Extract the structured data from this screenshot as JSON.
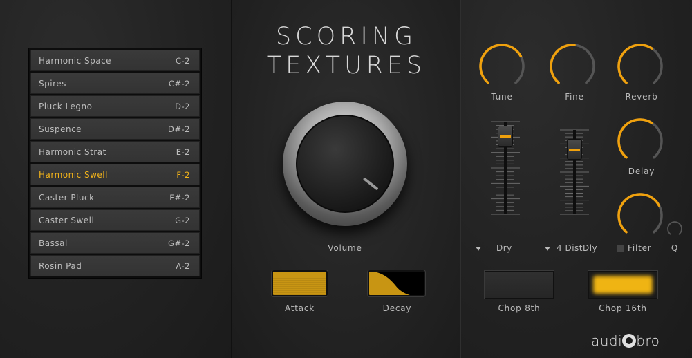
{
  "title": {
    "line1": "SCORING",
    "line2": "TEXTURES"
  },
  "presets": [
    {
      "name": "Harmonic Space",
      "note": "C-2"
    },
    {
      "name": "Spires",
      "note": "C#-2"
    },
    {
      "name": "Pluck Legno",
      "note": "D-2"
    },
    {
      "name": "Suspence",
      "note": "D#-2"
    },
    {
      "name": "Harmonic Strat",
      "note": "E-2"
    },
    {
      "name": "Harmonic Swell",
      "note": "F-2"
    },
    {
      "name": "Caster Pluck",
      "note": "F#-2"
    },
    {
      "name": "Caster Swell",
      "note": "G-2"
    },
    {
      "name": "Bassal",
      "note": "G#-2"
    },
    {
      "name": "Rosin Pad",
      "note": "A-2"
    }
  ],
  "active_preset_index": 5,
  "volume": {
    "label": "Volume"
  },
  "attack": {
    "label": "Attack"
  },
  "decay": {
    "label": "Decay"
  },
  "knobs": {
    "tune": {
      "label": "Tune",
      "level": 0.72
    },
    "separator": "--",
    "fine": {
      "label": "Fine",
      "level": 0.52
    },
    "reverb": {
      "label": "Reverb",
      "level": 0.62
    },
    "delay": {
      "label": "Delay",
      "level": 0.62
    },
    "q": {
      "label": "Q",
      "level": 0.02
    },
    "filter_cutoff": {
      "level": 0.72
    }
  },
  "faders": {
    "dry": {
      "level": 0.92
    },
    "dist": {
      "level": 0.84
    }
  },
  "dropdowns": {
    "dry": "Dry",
    "fx": "4 DistDly"
  },
  "filter": {
    "label": "Filter"
  },
  "chop": {
    "eighth": "Chop 8th",
    "sixteenth": "Chop 16th"
  },
  "brand": {
    "part1": "audi",
    "part2": "bro"
  },
  "colors": {
    "accent": "#f0a10d",
    "active_text": "#f2b31a",
    "panel": "#232323"
  }
}
